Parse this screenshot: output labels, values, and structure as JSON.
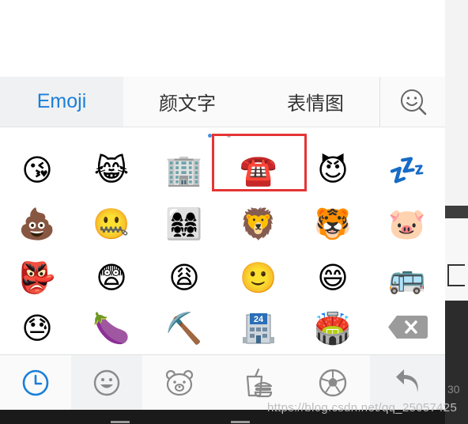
{
  "tabs": [
    {
      "label": "Emoji"
    },
    {
      "label": "颜文字"
    },
    {
      "label": "表情图"
    }
  ],
  "emoji_grid": [
    [
      "😘",
      "😹",
      "🏢",
      "☎️",
      "😈",
      "💤"
    ],
    [
      "💩",
      "🤐",
      "👩‍👩‍👧‍👧",
      "🦁",
      "🐯",
      "🐷"
    ],
    [
      "👺",
      "😨",
      "😩",
      "🙂",
      "😄",
      "🚌"
    ],
    [
      "😓",
      "🍆",
      "⛏️",
      "🏪",
      "🏟️",
      ""
    ]
  ],
  "store_badge": "24",
  "highlighted_emoji": "☎️",
  "watermark": "https://blog.csdn.net/qq_25057425",
  "side_text": "30",
  "colors": {
    "accent": "#1a7fd9",
    "highlight_border": "#e53434",
    "icon_gray": "#8a8a8a"
  },
  "icons": [
    "search-face-icon",
    "clock-icon",
    "smiley-icon",
    "bear-icon",
    "food-icon",
    "soccer-ball-icon",
    "return-arrow-icon",
    "backspace-icon"
  ]
}
